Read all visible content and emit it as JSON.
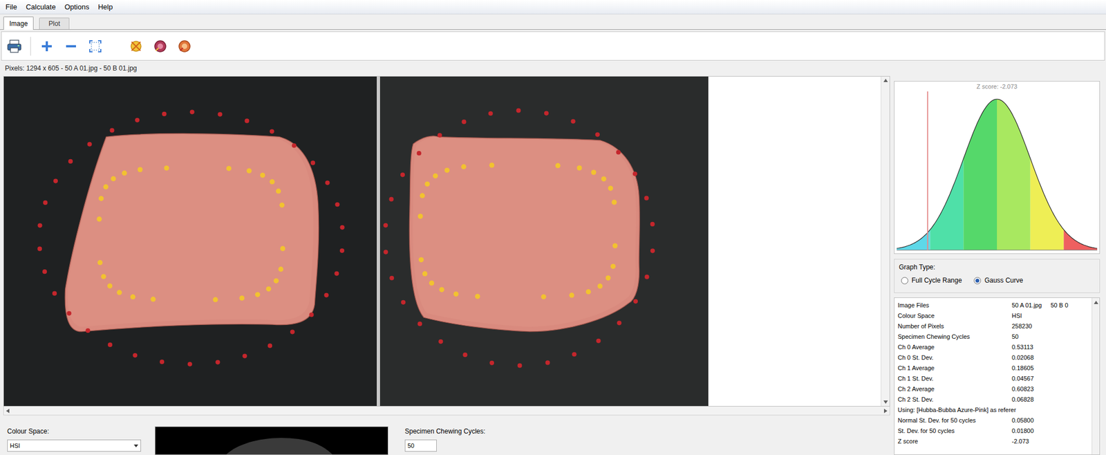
{
  "menu": [
    "File",
    "Calculate",
    "Options",
    "Help"
  ],
  "tabs": [
    {
      "label": "Image",
      "selected": true
    },
    {
      "label": "Plot",
      "selected": false
    }
  ],
  "info_line": "Pixels: 1294 x 605 - 50 A 01.jpg - 50 B 01.jpg",
  "chart": {
    "title": "Z score: -2.073",
    "z": -2.073,
    "x_min": -3,
    "x_max": 3,
    "bands": [
      {
        "from": -3,
        "to": -2,
        "color": "#5ed8e8"
      },
      {
        "from": -2,
        "to": -1,
        "color": "#4fe0a8"
      },
      {
        "from": -1,
        "to": 0,
        "color": "#55d86a"
      },
      {
        "from": 0,
        "to": 1,
        "color": "#a8e860"
      },
      {
        "from": 1,
        "to": 2,
        "color": "#eeee55"
      },
      {
        "from": 2,
        "to": 3,
        "color": "#ee6060"
      }
    ]
  },
  "graph_type": {
    "label": "Graph Type:",
    "options": [
      {
        "label": "Full Cycle Range",
        "selected": false
      },
      {
        "label": "Gauss Curve",
        "selected": true
      }
    ]
  },
  "results": [
    {
      "key": "Image Files",
      "values": [
        "50 A 01.jpg",
        "50 B 0"
      ]
    },
    {
      "key": "Colour Space",
      "values": [
        "HSI"
      ]
    },
    {
      "key": "Number of Pixels",
      "values": [
        "258230"
      ]
    },
    {
      "key": "Specimen Chewing Cycles",
      "values": [
        "50"
      ]
    },
    {
      "key": "Ch 0 Average",
      "values": [
        "0.53113"
      ]
    },
    {
      "key": "Ch 0 St. Dev.",
      "values": [
        "0.02068"
      ]
    },
    {
      "key": "Ch 1 Average",
      "values": [
        "0.18605"
      ]
    },
    {
      "key": "Ch 1 St. Dev.",
      "values": [
        "0.04567"
      ]
    },
    {
      "key": "Ch 2 Average",
      "values": [
        "0.60823"
      ]
    },
    {
      "key": "Ch 2 St. Dev.",
      "values": [
        "0.06828"
      ]
    },
    {
      "key": "Using: [Hubba-Bubba Azure-Pink] as referer",
      "values": []
    },
    {
      "key": "Normal St. Dev. for 50 cycles",
      "values": [
        "0.05800"
      ]
    },
    {
      "key": "St. Dev. for 50 cycles",
      "values": [
        "0.01800"
      ]
    },
    {
      "key": "Z score",
      "values": [
        "-2.073"
      ]
    }
  ],
  "colour_space": {
    "label": "Colour Space:",
    "value": "HSI"
  },
  "cycles": {
    "label": "Specimen Chewing Cycles:",
    "value": "50"
  }
}
